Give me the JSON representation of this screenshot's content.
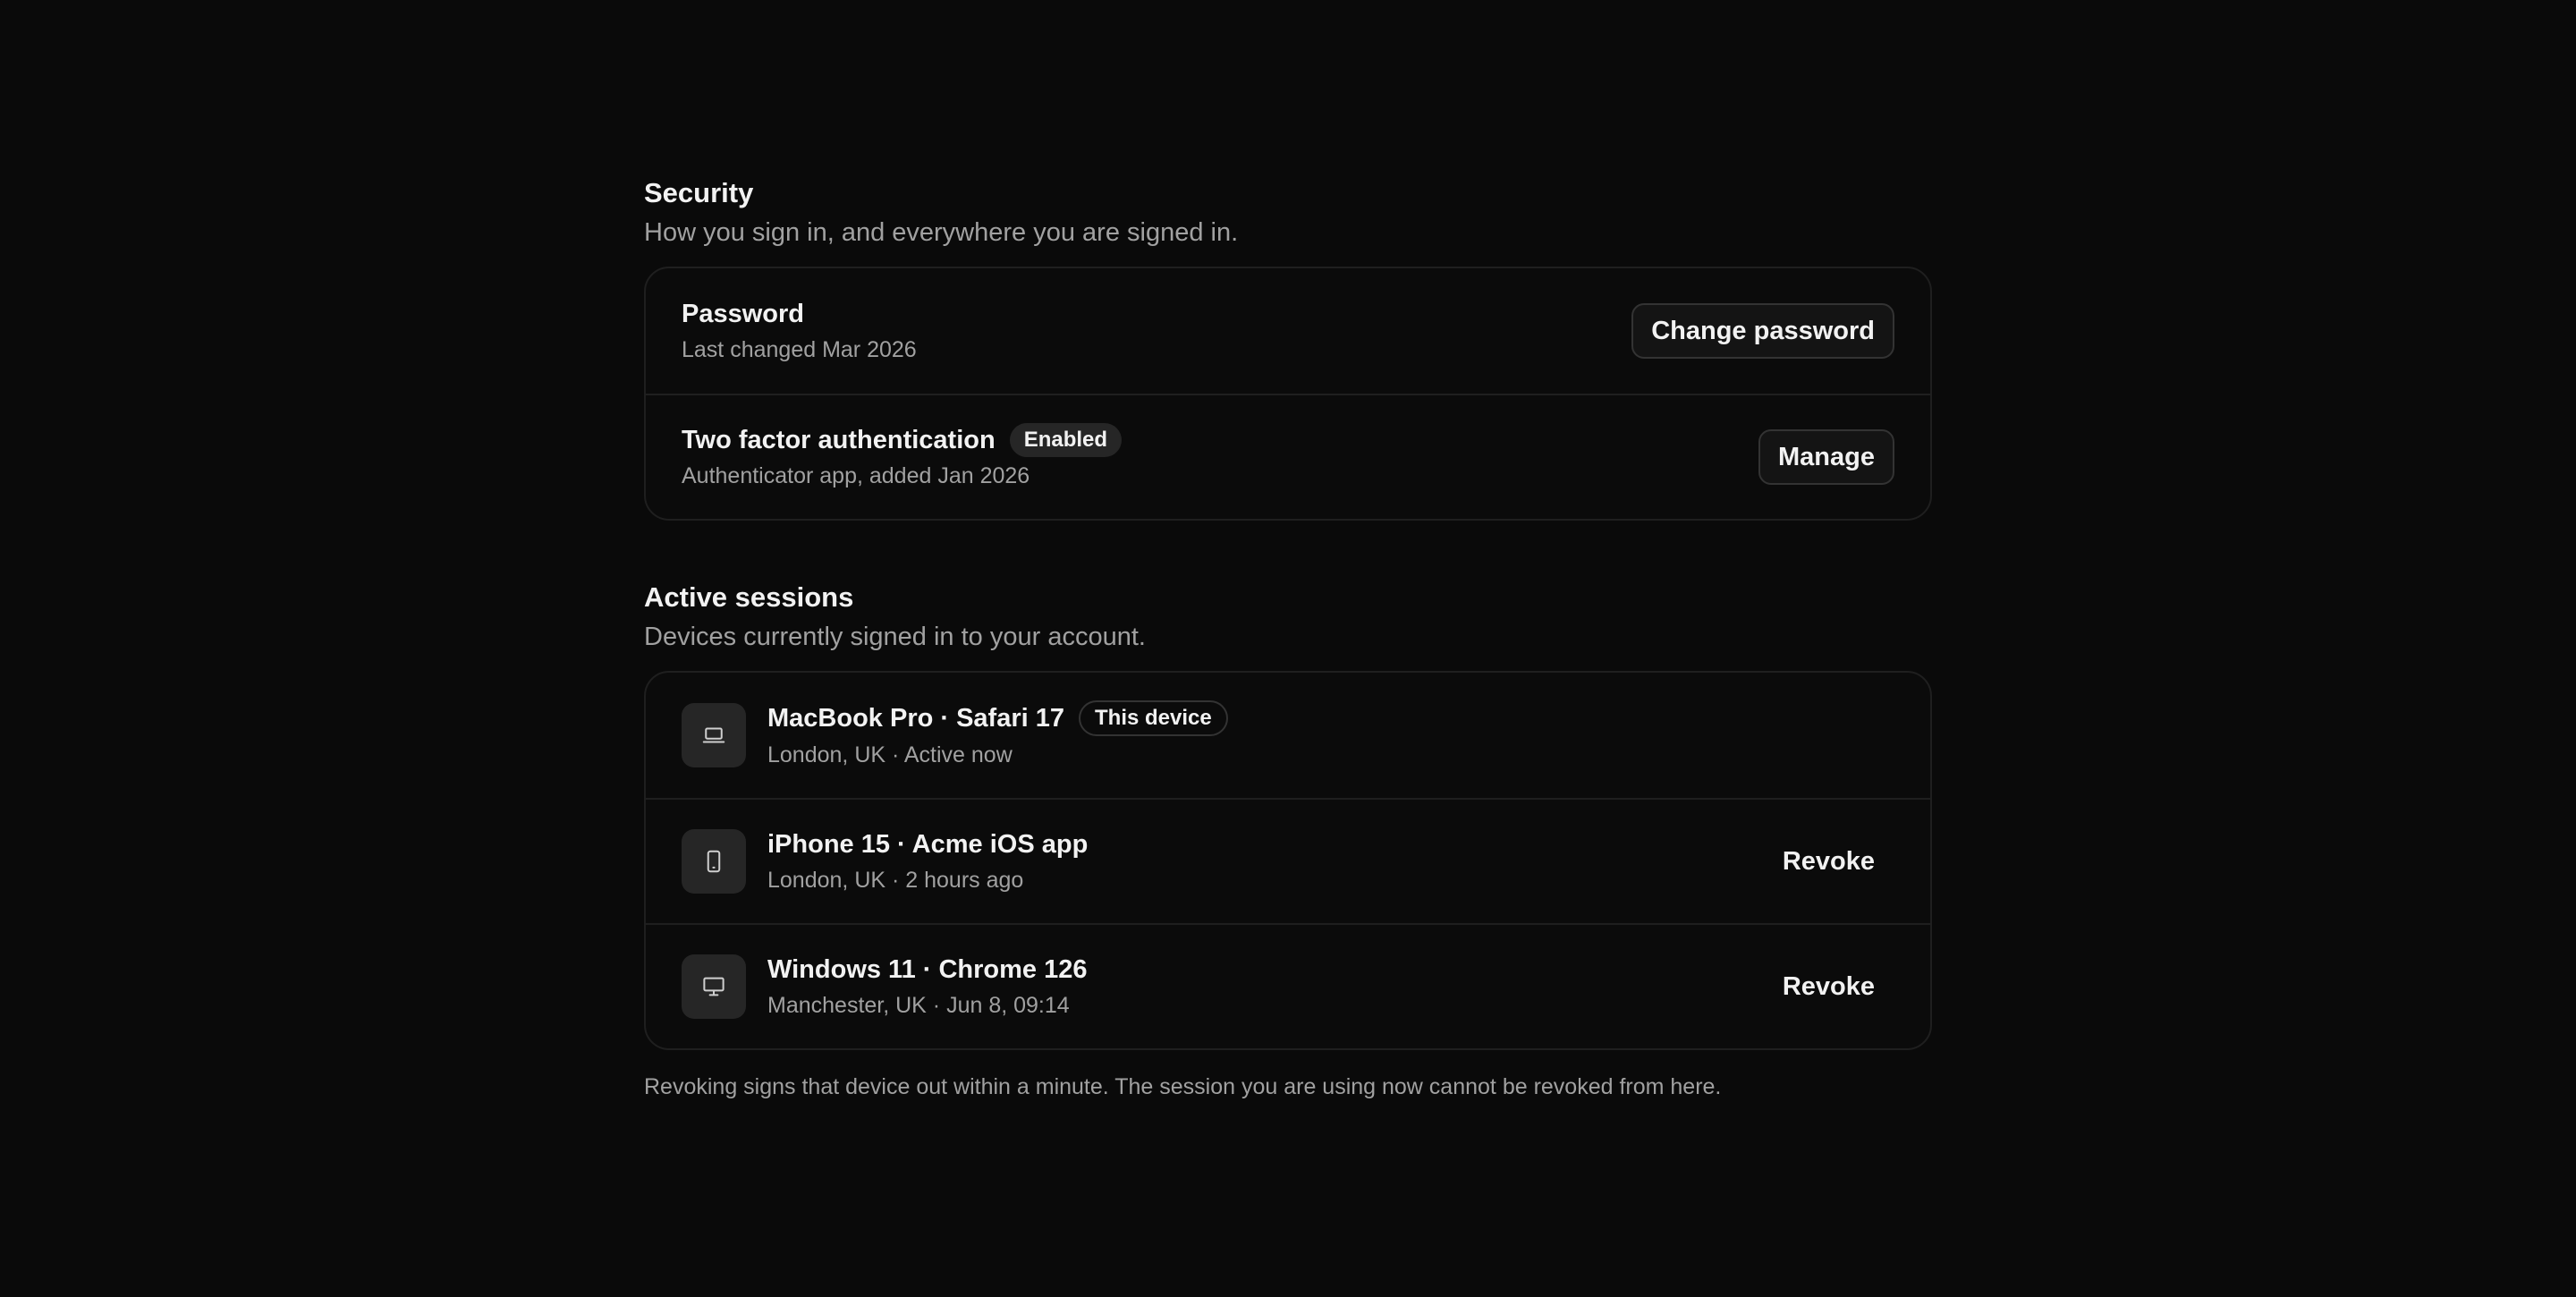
{
  "security": {
    "title": "Security",
    "subtitle": "How you sign in, and everywhere you are signed in.",
    "password": {
      "title": "Password",
      "subtitle": "Last changed Mar 2026",
      "button_label": "Change password"
    },
    "two_factor": {
      "title": "Two factor authentication",
      "badge": "Enabled",
      "subtitle": "Authenticator app, added Jan 2026",
      "button_label": "Manage"
    }
  },
  "sessions": {
    "title": "Active sessions",
    "subtitle": "Devices currently signed in to your account.",
    "items": [
      {
        "icon": "laptop-icon",
        "title": "MacBook Pro · Safari 17",
        "badge": "This device",
        "subtitle": "London, UK · Active now"
      },
      {
        "icon": "phone-icon",
        "title": "iPhone 15 · Acme iOS app",
        "subtitle": "London, UK · 2 hours ago",
        "action_label": "Revoke"
      },
      {
        "icon": "desktop-icon",
        "title": "Windows 11 · Chrome 126",
        "subtitle": "Manchester, UK · Jun 8, 09:14",
        "action_label": "Revoke"
      }
    ],
    "footnote": "Revoking signs that device out within a minute. The session you are using now cannot be revoked from here."
  },
  "colors": {
    "background": "#0a0a0a",
    "card_border": "#1f1f1f",
    "muted_text": "#a1a1a1",
    "icon_tile": "#262626"
  }
}
